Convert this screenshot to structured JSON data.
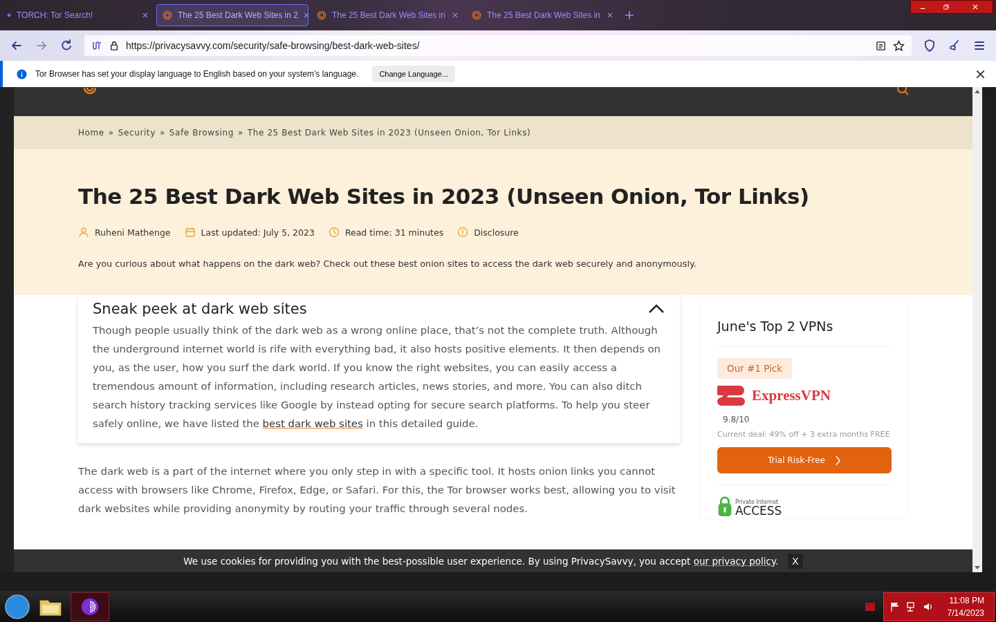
{
  "browser": {
    "tabs": [
      {
        "title": "TORCH: Tor Search!",
        "kind": "dot",
        "selected": false
      },
      {
        "title": "The 25 Best Dark Web Sites in 2",
        "kind": "onion",
        "selected": true
      },
      {
        "title": "The 25 Best Dark Web Sites in",
        "kind": "onion",
        "selected": false
      },
      {
        "title": "The 25 Best Dark Web Sites in",
        "kind": "onion",
        "selected": false
      }
    ],
    "url": "https://privacysavvy.com/security/safe-browsing/best-dark-web-sites/",
    "notification": {
      "message": "Tor Browser has set your display language to English based on your system’s language.",
      "button": "Change Language..."
    }
  },
  "page": {
    "breadcrumb_separator": "»",
    "breadcrumb": [
      "Home",
      "Security",
      "Safe Browsing",
      "The 25 Best Dark Web Sites in 2023 (Unseen Onion, Tor Links)"
    ],
    "title": "The 25 Best Dark Web Sites in 2023 (Unseen Onion, Tor Links)",
    "meta": [
      {
        "kind": "author",
        "text": "Ruheni Mathenge"
      },
      {
        "kind": "date",
        "text": "Last updated: July 5, 2023"
      },
      {
        "kind": "time",
        "text": "Read time: 31 minutes"
      },
      {
        "kind": "info",
        "text": "Disclosure"
      }
    ],
    "intro": "Are you curious about what happens on the dark web? Check out these best onion sites to access the dark web securely and anonymously.",
    "summary": {
      "title": "Sneak peek at dark web sites",
      "expanded": true,
      "before": "Though people usually think of the dark web as a wrong online place, that’s not the complete truth. Although the underground internet world is rife with everything bad, it also hosts positive elements. It then depends on you, as the user, how you surf the dark world. If you know the right websites, you can easily access a tremendous amount of information, including research articles, news stories, and more. You can also ditch search history tracking services like Google by instead opting for secure search platforms. To help you steer safely online, we have listed the ",
      "link": "best dark web sites",
      "after": " in this detailed guide."
    },
    "body": "The dark web is a part of the internet where you only step in with a specific tool. It hosts onion links you cannot access with browsers like Chrome, Firefox, Edge, or Safari. For this, the Tor browser works best, allowing you to visit dark websites while providing anonymity by routing your traffic through several nodes.",
    "sidebar": {
      "title": "June's Top 2 VPNs",
      "badge": "Our #1 Pick",
      "brand": "ExpressVPN",
      "score": "9.8/10",
      "deal": "Current deal: 49% off + 3 extra months FREE",
      "button": "Trial Risk-Free",
      "next_brand_top": "Private Internet",
      "next_brand": "ACCESS"
    },
    "cookie": {
      "text": "We use cookies for providing you with the best-possible user experience. By using PrivacySavvy, you accept ",
      "link": "our privacy policy",
      "after": ".",
      "close": "X"
    }
  },
  "taskbar": {
    "time": "11:08 PM",
    "date": "7/14/2023"
  }
}
